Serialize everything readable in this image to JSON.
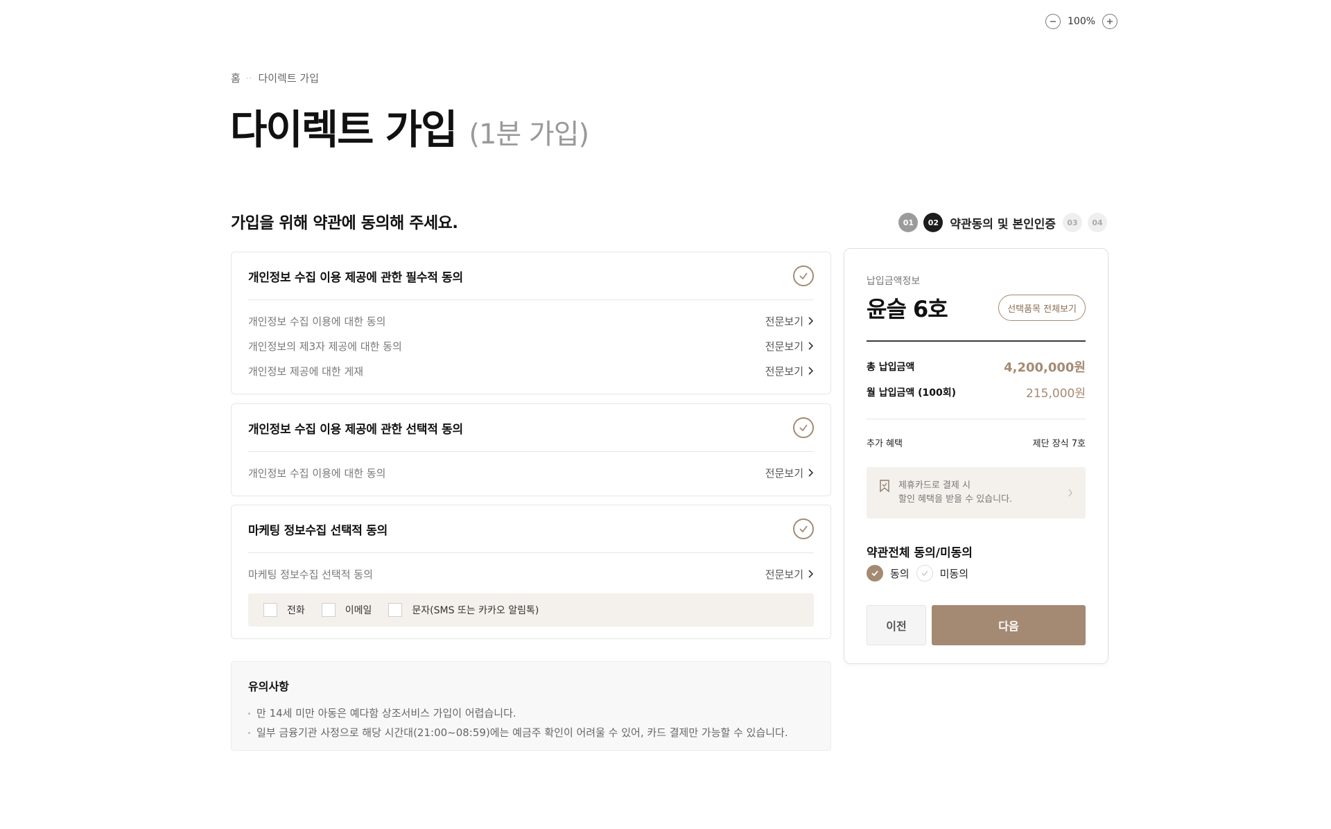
{
  "zoom": {
    "level": "100%"
  },
  "breadcrumb": {
    "home": "홈",
    "current": "다이렉트 가입"
  },
  "page": {
    "title": "다이렉트 가입",
    "subtitle": "(1분 가입)"
  },
  "section": {
    "heading": "가입을 위해 약관에 동의해 주세요."
  },
  "steps": {
    "s1": "01",
    "s2": "02",
    "s2_label": "약관동의 및 본인인증",
    "s3": "03",
    "s4": "04"
  },
  "terms": {
    "required": {
      "title": "개인정보 수집 이용 제공에 관한 필수적 동의",
      "items": [
        {
          "label": "개인정보 수집 이용에 대한 동의",
          "link": "전문보기"
        },
        {
          "label": "개인정보의 제3자 제공에 대한 동의",
          "link": "전문보기"
        },
        {
          "label": "개인정보 제공에 대한 게재",
          "link": "전문보기"
        }
      ]
    },
    "optional": {
      "title": "개인정보 수집 이용 제공에 관한 선택적 동의",
      "items": [
        {
          "label": "개인정보 수집 이용에 대한 동의",
          "link": "전문보기"
        }
      ]
    },
    "marketing": {
      "title": "마케팅 정보수집 선택적 동의",
      "items": [
        {
          "label": "마케팅 정보수집 선택적 동의",
          "link": "전문보기"
        }
      ],
      "channels": [
        "전화",
        "이메일",
        "문자(SMS 또는 카카오 알림톡)"
      ]
    }
  },
  "notice": {
    "title": "유의사항",
    "items": [
      "만 14세 미만 아동은 예다함 상조서비스 가입이 어렵습니다.",
      "일부 금융기관 사정으로 해당 시간대(21:00~08:59)에는 예금주 확인이 어려울 수 있어, 카드 결제만 가능할 수 있습니다."
    ]
  },
  "summary": {
    "caption": "납입금액정보",
    "product": "윤슬 6호",
    "view_all": "선택품목 전체보기",
    "total_label": "총 납입금액",
    "total_value": "4,200,000원",
    "monthly_label": "월 납입금액 (100회)",
    "monthly_value": "215,000원",
    "benefit_label": "추가 혜택",
    "benefit_value": "제단 장식 7호",
    "promo_line1": "제휴카드로 결제 시",
    "promo_line2": "할인 혜택을 받을 수 있습니다.",
    "all_agree_title": "약관전체 동의/미동의",
    "agree": "동의",
    "disagree": "미동의",
    "prev": "이전",
    "next": "다음"
  },
  "colors": {
    "accent": "#a48a72",
    "panel_bg": "#f4f1ec"
  }
}
